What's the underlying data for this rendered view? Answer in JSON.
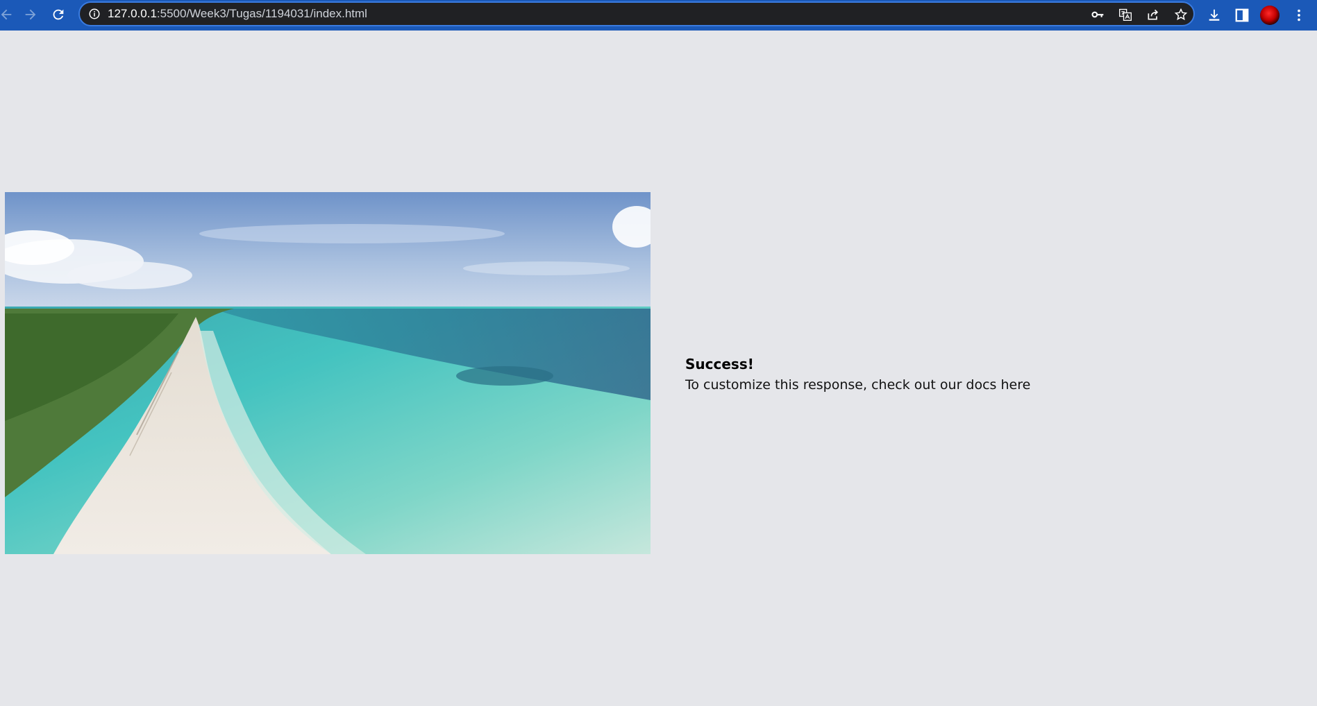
{
  "browser": {
    "url_host": "127.0.0.1",
    "url_rest": ":5500/Week3/Tugas/1194031/index.html",
    "toolbar_color": "#1b59b8",
    "omnibox_color": "#202124",
    "icons": [
      "back-icon",
      "forward-icon",
      "reload-icon",
      "site-info-icon",
      "key-icon",
      "translate-icon",
      "share-icon",
      "star-icon",
      "download-icon",
      "side-panel-icon",
      "profile-avatar",
      "menu-icon"
    ]
  },
  "page": {
    "background": "#e5e6ea",
    "image_alt": "Aerial view of a tropical beach with turquoise water",
    "response_title": "Success!",
    "response_text": "To customize this response, check out our docs here"
  }
}
